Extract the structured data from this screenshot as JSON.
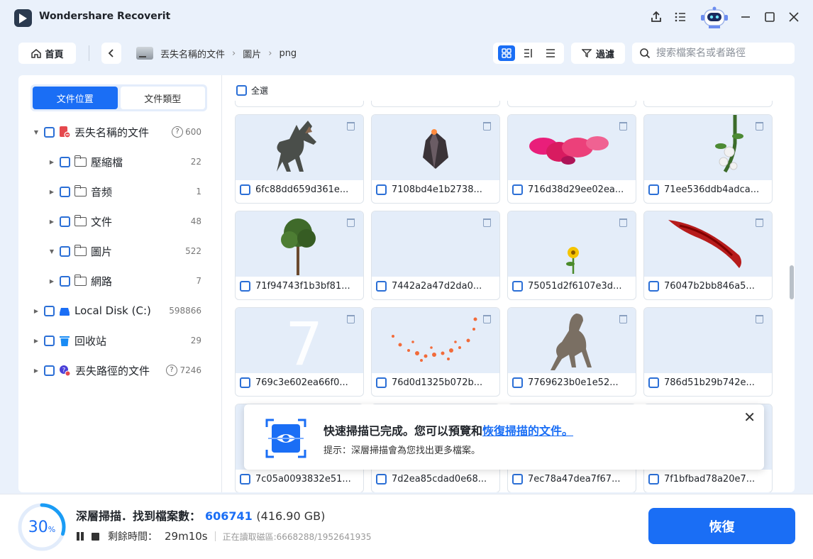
{
  "app": {
    "title": "Wondershare Recoverit"
  },
  "toolbar": {
    "home_label": "首頁",
    "breadcrumb": [
      "丟失名稱的文件",
      "圖片",
      "png"
    ],
    "filter_label": "過濾",
    "search_placeholder": "搜索檔案名或者路徑"
  },
  "sidebar": {
    "tabs": [
      "文件位置",
      "文件類型"
    ],
    "active_tab": 0,
    "tree": [
      {
        "label": "丟失名稱的文件",
        "count": "600",
        "expanded": true,
        "icon": "lost-file-icon",
        "help": true
      },
      {
        "label": "壓縮檔",
        "count": "22",
        "icon": "folder-icon"
      },
      {
        "label": "音频",
        "count": "1",
        "icon": "folder-icon"
      },
      {
        "label": "文件",
        "count": "48",
        "icon": "folder-icon"
      },
      {
        "label": "圖片",
        "count": "522",
        "expanded": true,
        "icon": "folder-icon"
      },
      {
        "label": "網路",
        "count": "7",
        "icon": "folder-icon"
      },
      {
        "label": "Local Disk (C:)",
        "count": "598866",
        "icon": "drive-icon"
      },
      {
        "label": "回收站",
        "count": "29",
        "icon": "recycle-bin-icon"
      },
      {
        "label": "丟失路徑的文件",
        "count": "7246",
        "icon": "lost-path-icon",
        "help": true
      }
    ]
  },
  "content": {
    "select_all_label": "全選",
    "files": [
      {
        "name": "6fc88dd659d361e...",
        "thumb": "dinosaur"
      },
      {
        "name": "7108bd4e1b2738...",
        "thumb": "crystal"
      },
      {
        "name": "716d38d29ee02ea...",
        "thumb": "pink-smoke"
      },
      {
        "name": "71ee536ddb4adca...",
        "thumb": "white-flowers"
      },
      {
        "name": "71f94743f1b3bf81...",
        "thumb": "tree"
      },
      {
        "name": "7442a2a47d2da0...",
        "thumb": "blank"
      },
      {
        "name": "75051d2f6107e3d...",
        "thumb": "yellow-flower"
      },
      {
        "name": "76047b2bb846a5...",
        "thumb": "red-wing"
      },
      {
        "name": "769c3e602ea66f0...",
        "thumb": "number-seven"
      },
      {
        "name": "76d0d1325b072b...",
        "thumb": "orange-particles"
      },
      {
        "name": "7769623b0e1e52...",
        "thumb": "creature"
      },
      {
        "name": "786d51b29b742e...",
        "thumb": "blank"
      },
      {
        "name": "7c05a0093832e51...",
        "thumb": "hidden"
      },
      {
        "name": "7d2ea85cdad0e68...",
        "thumb": "hidden"
      },
      {
        "name": "7ec78a47dea7f67...",
        "thumb": "hidden"
      },
      {
        "name": "7f1bfbad78a20e7...",
        "thumb": "hidden"
      }
    ]
  },
  "notice": {
    "title_prefix": "快速掃描已完成。您可以預覽和",
    "title_link": "恢復掃描的文件。",
    "subtitle": "提示：深層掃描會為您找出更多檔案。"
  },
  "status": {
    "progress_percent": 30,
    "progress_suffix": "%",
    "title": "深層掃描．找到檔案數：",
    "file_count": "606741",
    "total_size": "(416.90 GB)",
    "remaining_label": "剩餘時間：",
    "remaining_time": "29m10s",
    "reading": "正在讀取磁區:6668288/1952641935",
    "recover_label": "恢復"
  },
  "colors": {
    "accent": "#1a6ef5",
    "window_bg": "#eaf1fb",
    "thumb_bg": "#e4edf9"
  }
}
